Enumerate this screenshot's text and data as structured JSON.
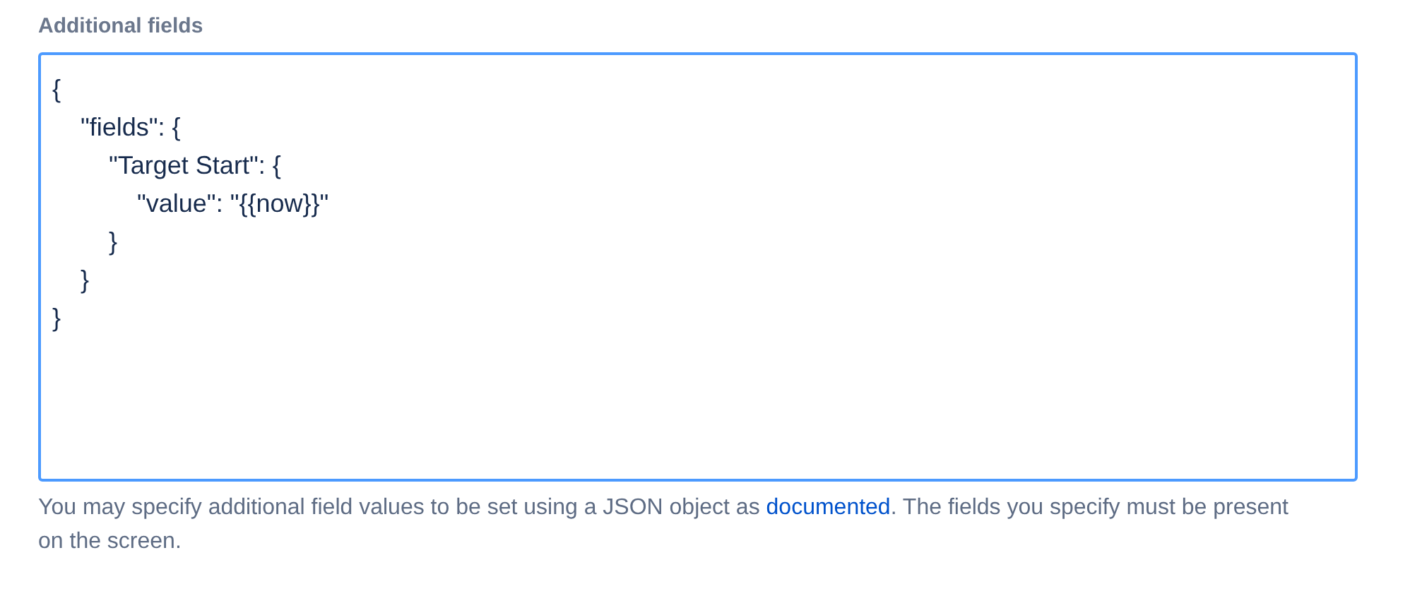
{
  "field": {
    "label": "Additional fields",
    "focused": true,
    "value": "{\n    \"fields\": {\n        \"Target Start\": {\n            \"value\": \"{{now}}\"\n        }\n    }\n}"
  },
  "help": {
    "text_before": "You may specify additional field values to be set using a JSON object as ",
    "link": "documented",
    "text_after": ". The fields you specify must be present on the screen."
  }
}
